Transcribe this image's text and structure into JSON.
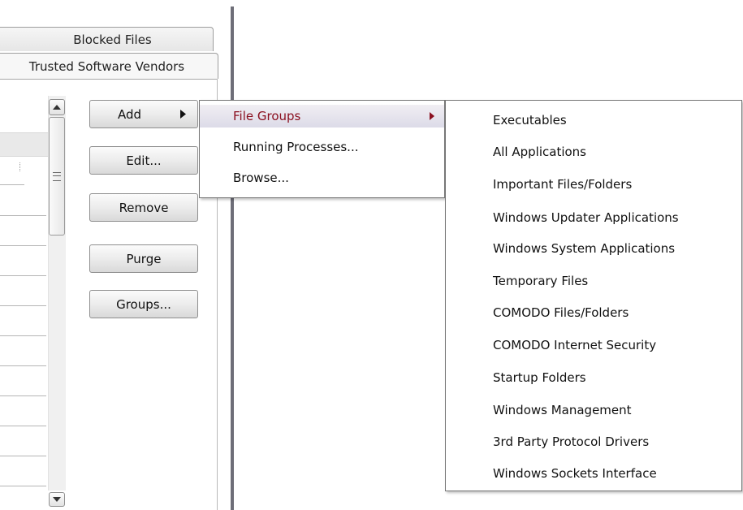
{
  "tabs": {
    "blocked_files": "Blocked Files",
    "trusted_vendors": "Trusted Software Vendors"
  },
  "buttons": {
    "add": "Add",
    "edit": "Edit...",
    "remove": "Remove",
    "purge": "Purge",
    "groups": "Groups..."
  },
  "add_menu": {
    "items": [
      "File Groups",
      "Running Processes...",
      "Browse..."
    ],
    "highlighted": "File Groups",
    "highlight_text_color": "#8b1020"
  },
  "file_groups_menu": {
    "items": [
      "Executables",
      "All Applications",
      "Important Files/Folders",
      "Windows Updater Applications",
      "Windows System Applications",
      "Temporary Files",
      "COMODO Files/Folders",
      "COMODO Internet Security",
      "Startup Folders",
      "Windows Management",
      "3rd Party Protocol Drivers",
      "Windows Sockets Interface"
    ]
  },
  "icons": {
    "add_arrow": "triangle-right-icon",
    "submenu_arrow": "triangle-right-icon",
    "scroll_up": "scroll-up-icon",
    "scroll_down": "scroll-down-icon",
    "scroll_grip": "grip-icon"
  }
}
